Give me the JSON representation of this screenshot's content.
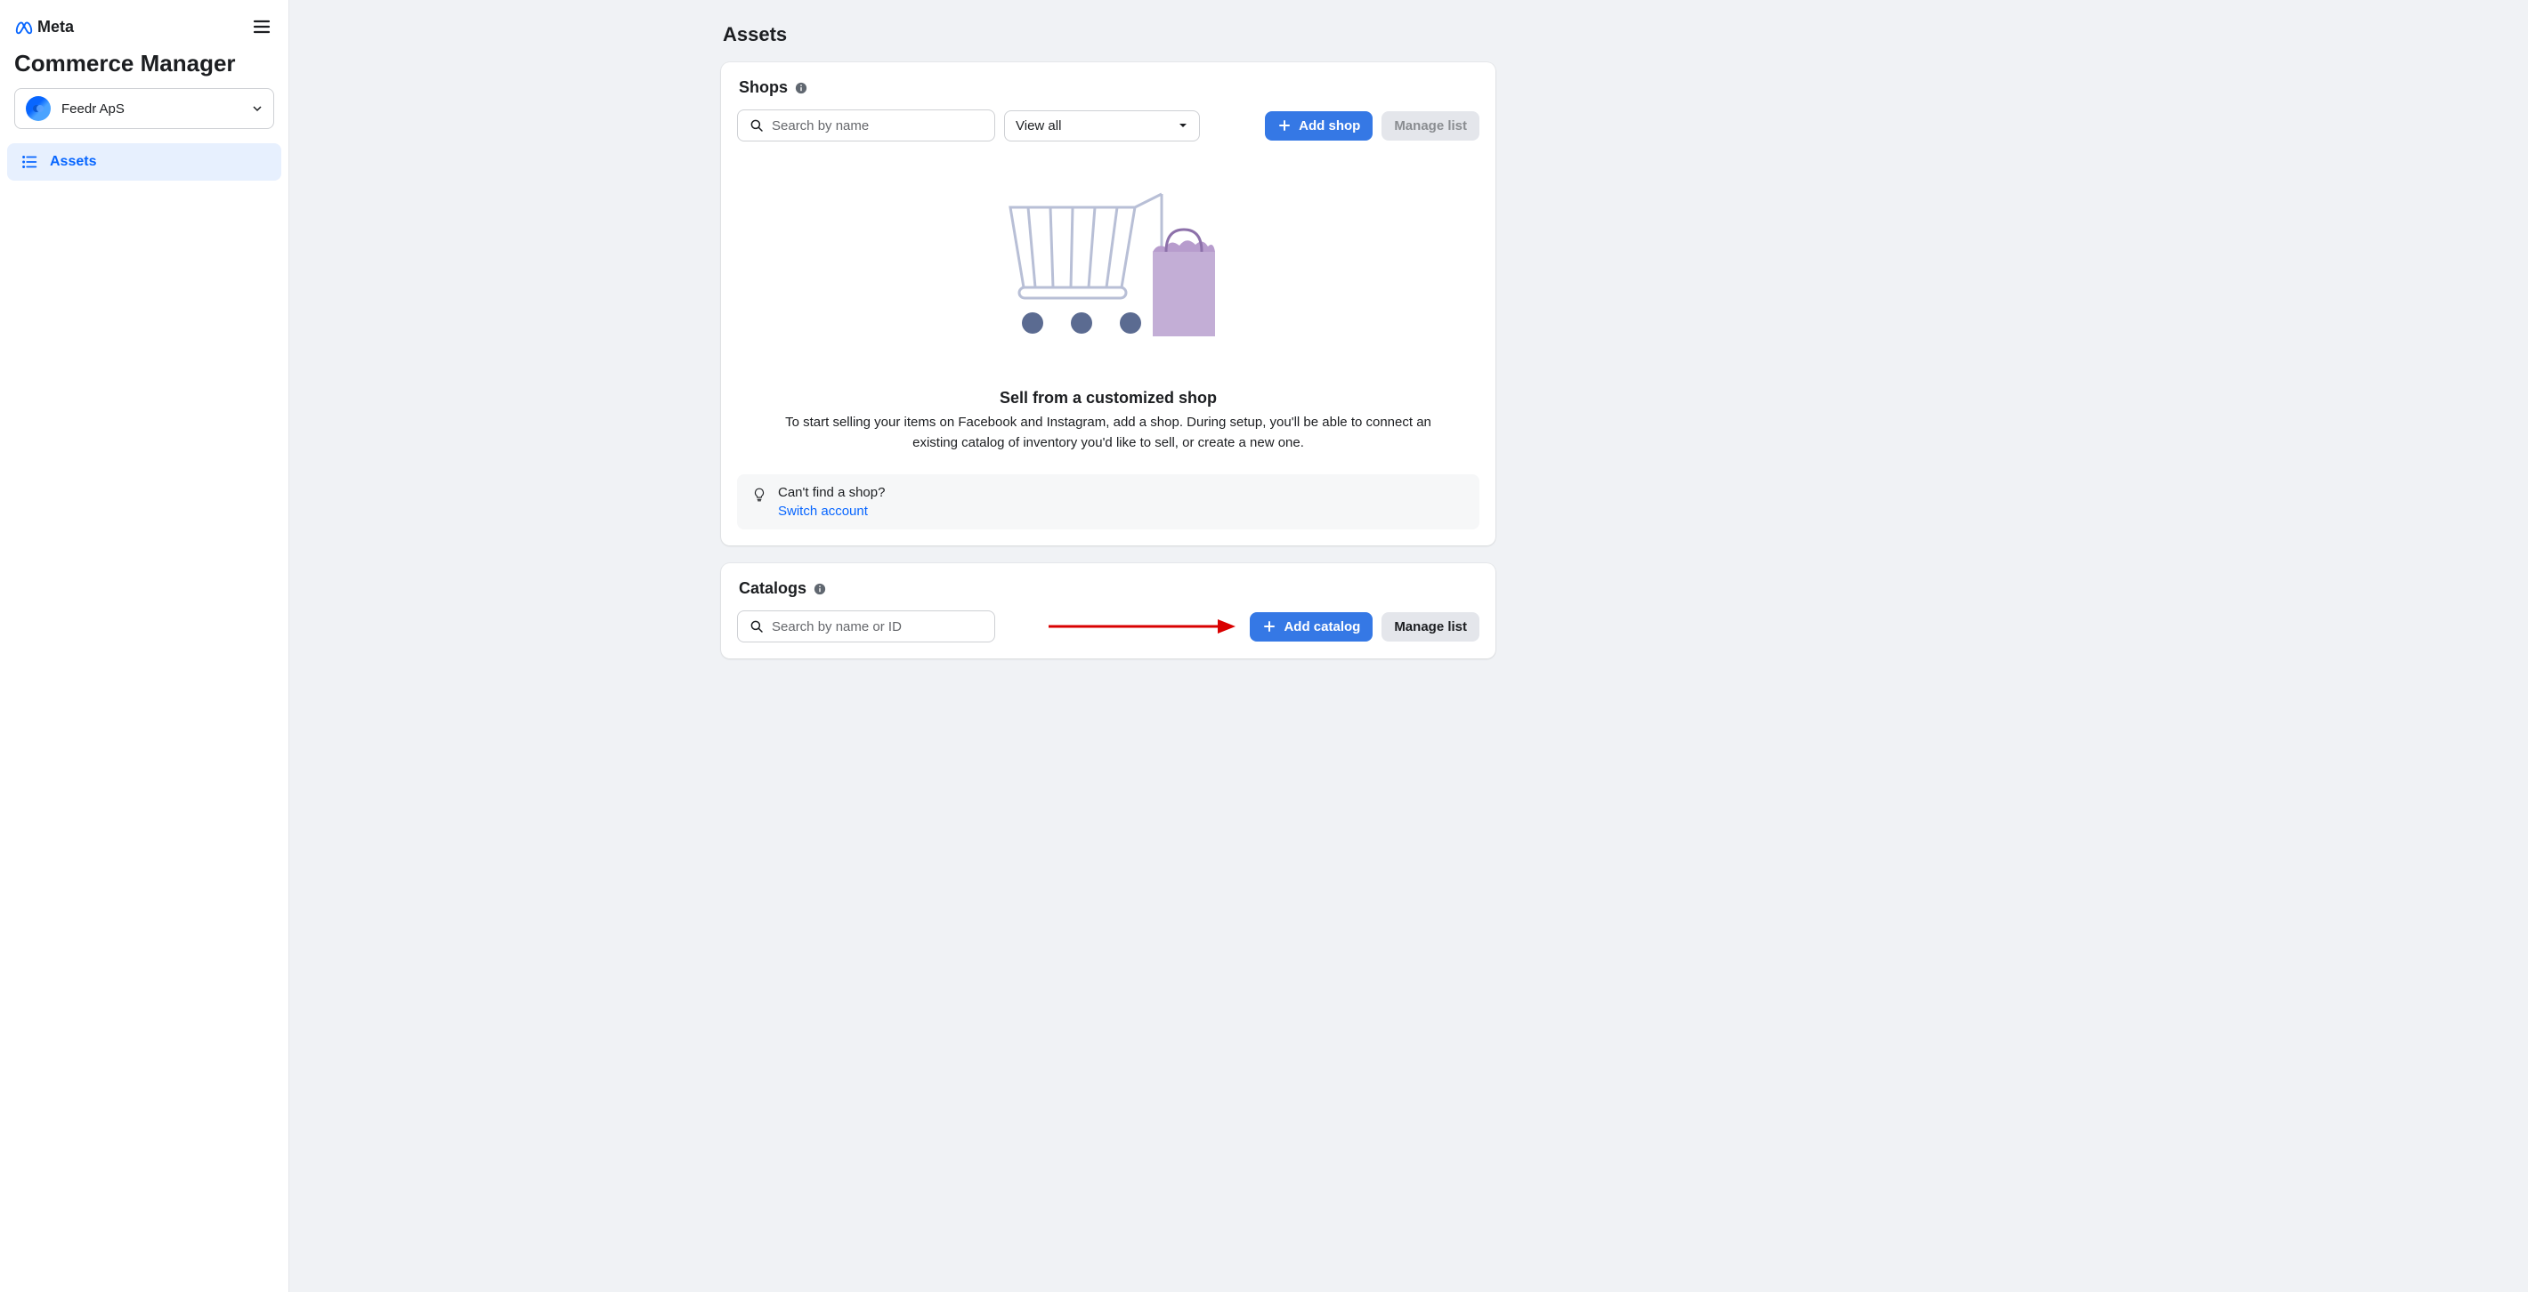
{
  "brand": {
    "name": "Meta"
  },
  "app": {
    "title": "Commerce Manager"
  },
  "account": {
    "name": "Feedr ApS"
  },
  "nav": {
    "assets_label": "Assets"
  },
  "page": {
    "title": "Assets"
  },
  "shops": {
    "section_label": "Shops",
    "search_placeholder": "Search by name",
    "filter_selected": "View all",
    "add_button": "Add shop",
    "manage_button": "Manage list",
    "empty_heading": "Sell from a customized shop",
    "empty_body": "To start selling your items on Facebook and Instagram, add a shop. During setup, you'll be able to connect an existing catalog of inventory you'd like to sell, or create a new one.",
    "callout_title": "Can't find a shop?",
    "callout_link": "Switch account"
  },
  "catalogs": {
    "section_label": "Catalogs",
    "search_placeholder": "Search by name or ID",
    "add_button": "Add catalog",
    "manage_button": "Manage list"
  }
}
